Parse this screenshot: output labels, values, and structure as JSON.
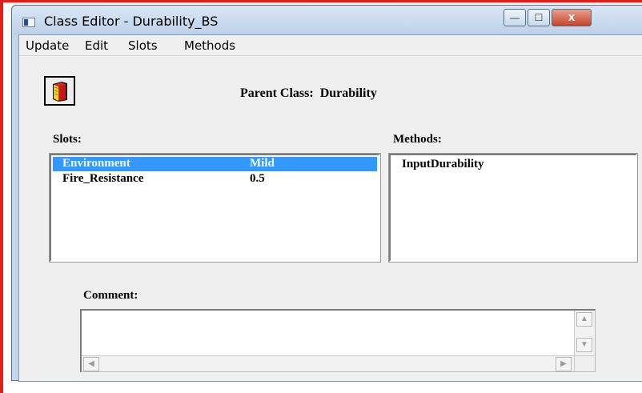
{
  "window": {
    "title": "Class Editor - Durability_BS",
    "controls": {
      "minimize": "—",
      "maximize": "☐",
      "close": "x"
    }
  },
  "menubar": {
    "items": [
      "Update",
      "Edit",
      "Slots",
      "Methods"
    ]
  },
  "toolbar": {
    "book_button_icon": "red-book-icon"
  },
  "parent_class": {
    "label": "Parent Class:",
    "value": "Durability"
  },
  "slots": {
    "label": "Slots:",
    "items": [
      {
        "name": "Environment",
        "value": "Mild",
        "selected": true
      },
      {
        "name": "Fire_Resistance",
        "value": "0.5",
        "selected": false
      }
    ]
  },
  "methods": {
    "label": "Methods:",
    "items": [
      "InputDurability"
    ]
  },
  "comment": {
    "label": "Comment:",
    "value": ""
  },
  "colors": {
    "selection": "#3399ff",
    "red_border": "#e0201c",
    "book_red": "#e1241c",
    "book_yellow": "#f5d21a"
  }
}
